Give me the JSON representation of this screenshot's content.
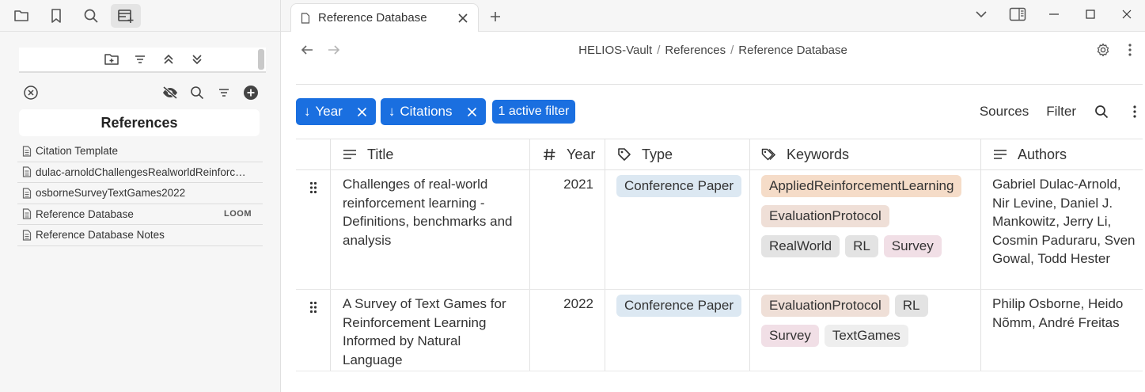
{
  "sidebar": {
    "list_header": "References",
    "items": [
      {
        "label": "Citation Template",
        "badge": ""
      },
      {
        "label": "dulac-arnoldChallengesRealworldReinforc…",
        "badge": ""
      },
      {
        "label": "osborneSurveyTextGames2022",
        "badge": ""
      },
      {
        "label": "Reference Database",
        "badge": "LOOM"
      },
      {
        "label": "Reference Database Notes",
        "badge": ""
      }
    ]
  },
  "tab": {
    "title": "Reference Database"
  },
  "breadcrumb": {
    "vault": "HELIOS-Vault",
    "folder": "References",
    "page": "Reference Database",
    "separator": "/"
  },
  "toolbar": {
    "sorts": [
      {
        "label": "Year",
        "arrow": "↓"
      },
      {
        "label": "Citations",
        "arrow": "↓"
      }
    ],
    "filter_label": "1 active filter",
    "sources_label": "Sources",
    "filter_button_label": "Filter"
  },
  "table": {
    "columns": [
      "Title",
      "Year",
      "Type",
      "Keywords",
      "Authors"
    ],
    "rows": [
      {
        "title": "Challenges of real-world reinforcement learning - Definitions, benchmarks and analysis",
        "year": "2021",
        "type": "Conference Paper",
        "keywords": [
          "AppliedReinforcementLearning",
          "EvaluationProtocol",
          "RealWorld",
          "RL",
          "Survey"
        ],
        "authors": "Gabriel Dulac-Arnold, Nir Levine, Daniel J. Mankowitz, Jerry Li, Cosmin Paduraru, Sven Gowal, Todd Hester"
      },
      {
        "title": "A Survey of Text Games for Reinforcement Learning Informed by Natural Language",
        "year": "2022",
        "type": "Conference Paper",
        "keywords": [
          "EvaluationProtocol",
          "RL",
          "Survey",
          "TextGames"
        ],
        "authors": "Philip Osborne, Heido Nõmm, André Freitas"
      }
    ]
  },
  "colors": {
    "accent": "#1a6fe0",
    "type_tag": "#dce8f2",
    "tag_applied": "#f5dcc8",
    "tag_evaluation": "#efdfd7",
    "tag_realworld": "#e3e3e3",
    "tag_rl": "#e3e3e3",
    "tag_survey": "#f1dfe6",
    "tag_textgames": "#eeeeee"
  }
}
